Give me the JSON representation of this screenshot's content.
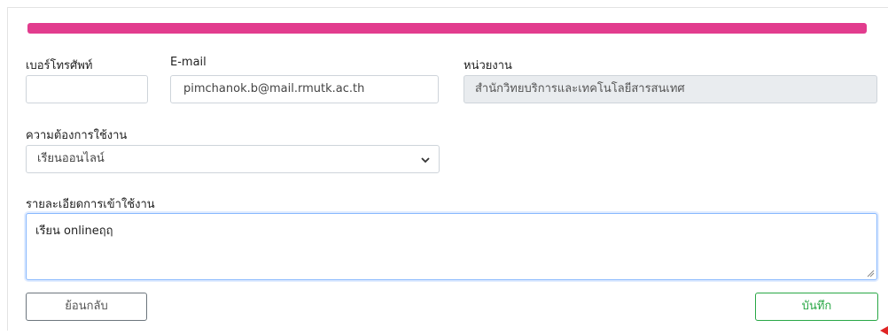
{
  "form": {
    "phone": {
      "label": "เบอร์โทรศัพท์",
      "value": ""
    },
    "email": {
      "label": "E-mail",
      "value": "pimchanok.b@mail.rmutk.ac.th"
    },
    "department": {
      "label": "หน่วยงาน",
      "value": "สำนักวิทยบริการและเทคโนโลยีสารสนเทศ"
    },
    "requirement": {
      "label": "ความต้องการใช้งาน",
      "selected": "เรียนออนไลน์"
    },
    "details": {
      "label": "รายละเอียดการเข้าใช้งาน",
      "value": "เรียน onlineฤฤ"
    }
  },
  "buttons": {
    "back_label": "ย้อนกลับ",
    "save_label": "บันทึก"
  },
  "colors": {
    "accent_bar": "#e23c8e",
    "save_button": "#28a745",
    "focus_border": "#86b7fe"
  }
}
